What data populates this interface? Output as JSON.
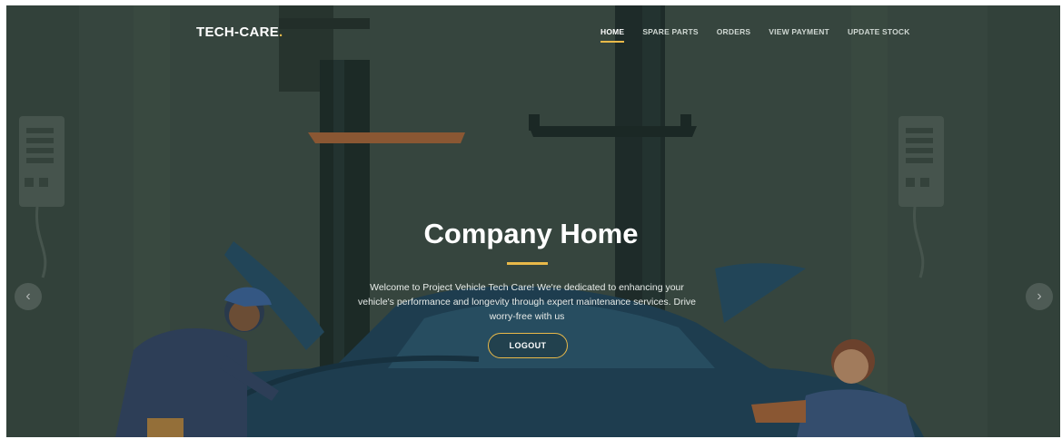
{
  "brand": {
    "name": "TECH-CARE",
    "dot": "."
  },
  "nav": [
    {
      "label": "HOME",
      "active": true
    },
    {
      "label": "SPARE PARTS",
      "active": false
    },
    {
      "label": "ORDERS",
      "active": false
    },
    {
      "label": "VIEW PAYMENT",
      "active": false
    },
    {
      "label": "UPDATE STOCK",
      "active": false
    }
  ],
  "hero": {
    "title": "Company Home",
    "description": "Welcome to Project Vehicle Tech Care! We're dedicated to enhancing your vehicle's performance and longevity through expert maintenance services. Drive worry-free with us",
    "button_label": "LOGOUT"
  },
  "carousel": {
    "prev_icon": "chevron-left-icon",
    "next_icon": "chevron-right-icon"
  },
  "colors": {
    "accent": "#e9b949",
    "background": "#3a4a43",
    "car": "#1f4560"
  }
}
